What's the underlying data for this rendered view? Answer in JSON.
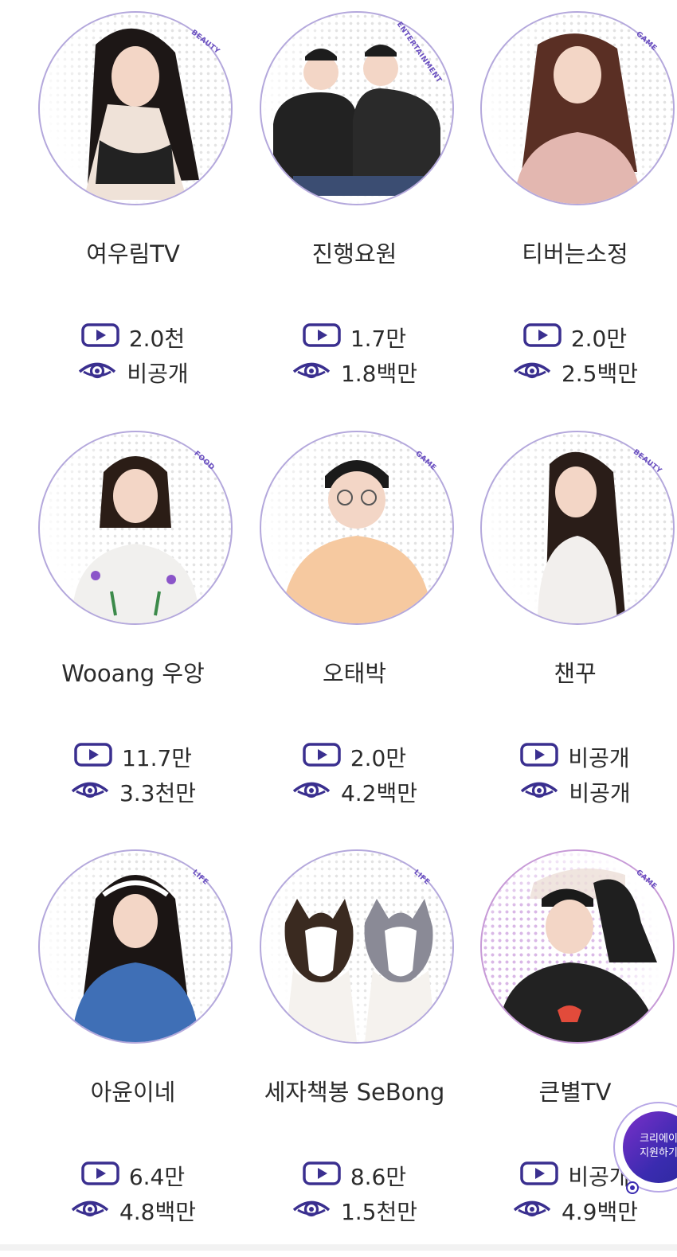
{
  "creators": [
    {
      "name": "여우림TV",
      "category": "BEAUTY",
      "videos": "2.0천",
      "views": "비공개",
      "avatar": "woman-long-dark-hair"
    },
    {
      "name": "진행요원",
      "category": "ENTERTAINMENT",
      "videos": "1.7만",
      "views": "1.8백만",
      "avatar": "two-men-black-tshirts"
    },
    {
      "name": "티버는소정",
      "category": "GAME",
      "videos": "2.0만",
      "views": "2.5백만",
      "avatar": "woman-pink-sweater"
    },
    {
      "name": "Wooang 우앙",
      "category": "FOOD",
      "videos": "11.7만",
      "views": "3.3천만",
      "avatar": "woman-floral-dress"
    },
    {
      "name": "오태박",
      "category": "GAME",
      "videos": "2.0만",
      "views": "4.2백만",
      "avatar": "man-glasses-peach-shirt"
    },
    {
      "name": "챈꾸",
      "category": "BEAUTY",
      "videos": "비공개",
      "views": "비공개",
      "avatar": "woman-white-top"
    },
    {
      "name": "아윤이네",
      "category": "LIFE",
      "videos": "6.4만",
      "views": "4.8백만",
      "avatar": "woman-headband-blue-sweater"
    },
    {
      "name": "세자책봉 SeBong",
      "category": "LIFE",
      "videos": "8.6만",
      "views": "1.5천만",
      "avatar": "two-sheltie-dogs"
    },
    {
      "name": "큰별TV",
      "category": "GAME",
      "videos": "비공개",
      "views": "4.9백만",
      "avatar": "man-black-hoodie"
    }
  ],
  "fab": {
    "line1": "크리에이",
    "line2": "지원하기"
  },
  "colors": {
    "accent": "#3a2f8f",
    "ring": "#b4a8dc",
    "fab": "#3a2bb0"
  }
}
